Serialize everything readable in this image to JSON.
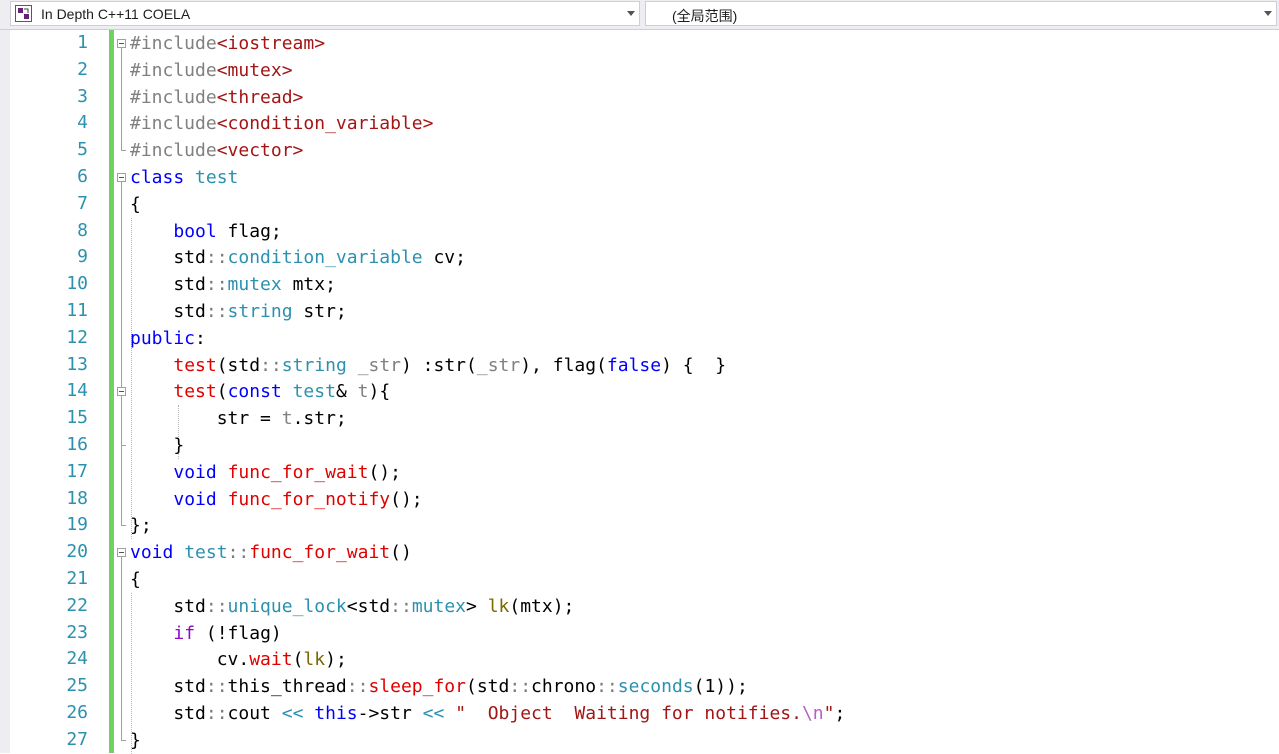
{
  "toolbar": {
    "project_label": "In Depth C++11 COELA",
    "scope_label": "(全局范围)",
    "project_icon": "project-icon"
  },
  "colors": {
    "line_number": "#2b91af",
    "change_bar": "#6cd35e",
    "keyword": "#0000ff",
    "type": "#2b91af",
    "function": "#e00000",
    "string": "#a31515",
    "preprocessor": "#808080"
  },
  "editor": {
    "lines": [
      {
        "n": "1",
        "tokens": [
          [
            "pre",
            "#include"
          ],
          [
            "inc",
            "<iostream>"
          ]
        ]
      },
      {
        "n": "2",
        "tokens": [
          [
            "pre",
            "#include"
          ],
          [
            "inc",
            "<mutex>"
          ]
        ]
      },
      {
        "n": "3",
        "tokens": [
          [
            "pre",
            "#include"
          ],
          [
            "inc",
            "<thread>"
          ]
        ]
      },
      {
        "n": "4",
        "tokens": [
          [
            "pre",
            "#include"
          ],
          [
            "inc",
            "<condition_variable>"
          ]
        ]
      },
      {
        "n": "5",
        "tokens": [
          [
            "pre",
            "#include"
          ],
          [
            "inc",
            "<vector>"
          ]
        ]
      },
      {
        "n": "6",
        "tokens": [
          [
            "kw",
            "class"
          ],
          [
            "plain",
            " "
          ],
          [
            "type",
            "test"
          ]
        ]
      },
      {
        "n": "7",
        "tokens": [
          [
            "plain",
            "{"
          ]
        ]
      },
      {
        "n": "8",
        "tokens": [
          [
            "plain",
            "    "
          ],
          [
            "kw",
            "bool"
          ],
          [
            "plain",
            " flag;"
          ]
        ]
      },
      {
        "n": "9",
        "tokens": [
          [
            "plain",
            "    std"
          ],
          [
            "mem",
            "::"
          ],
          [
            "type",
            "condition_variable"
          ],
          [
            "plain",
            " cv;"
          ]
        ]
      },
      {
        "n": "10",
        "tokens": [
          [
            "plain",
            "    std"
          ],
          [
            "mem",
            "::"
          ],
          [
            "type",
            "mutex"
          ],
          [
            "plain",
            " mtx;"
          ]
        ]
      },
      {
        "n": "11",
        "tokens": [
          [
            "plain",
            "    std"
          ],
          [
            "mem",
            "::"
          ],
          [
            "type",
            "string"
          ],
          [
            "plain",
            " str;"
          ]
        ]
      },
      {
        "n": "12",
        "tokens": [
          [
            "kw",
            "public"
          ],
          [
            "plain",
            ":"
          ]
        ]
      },
      {
        "n": "13",
        "tokens": [
          [
            "plain",
            "    "
          ],
          [
            "fn",
            "test"
          ],
          [
            "plain",
            "(std"
          ],
          [
            "mem",
            "::"
          ],
          [
            "type",
            "string"
          ],
          [
            "plain",
            " "
          ],
          [
            "par",
            "_str"
          ],
          [
            "plain",
            ") :str("
          ],
          [
            "par",
            "_str"
          ],
          [
            "plain",
            "), flag("
          ],
          [
            "kw",
            "false"
          ],
          [
            "plain",
            ") {  }"
          ]
        ]
      },
      {
        "n": "14",
        "tokens": [
          [
            "plain",
            "    "
          ],
          [
            "fn",
            "test"
          ],
          [
            "plain",
            "("
          ],
          [
            "kw",
            "const"
          ],
          [
            "plain",
            " "
          ],
          [
            "type",
            "test"
          ],
          [
            "plain",
            "& "
          ],
          [
            "par",
            "t"
          ],
          [
            "plain",
            "){"
          ]
        ]
      },
      {
        "n": "15",
        "tokens": [
          [
            "plain",
            "        str = "
          ],
          [
            "par",
            "t"
          ],
          [
            "plain",
            ".str;"
          ]
        ]
      },
      {
        "n": "16",
        "tokens": [
          [
            "plain",
            "    }"
          ]
        ]
      },
      {
        "n": "17",
        "tokens": [
          [
            "plain",
            "    "
          ],
          [
            "kw",
            "void"
          ],
          [
            "plain",
            " "
          ],
          [
            "fn",
            "func_for_wait"
          ],
          [
            "plain",
            "();"
          ]
        ]
      },
      {
        "n": "18",
        "tokens": [
          [
            "plain",
            "    "
          ],
          [
            "kw",
            "void"
          ],
          [
            "plain",
            " "
          ],
          [
            "fn",
            "func_for_notify"
          ],
          [
            "plain",
            "();"
          ]
        ]
      },
      {
        "n": "19",
        "tokens": [
          [
            "plain",
            "};"
          ]
        ]
      },
      {
        "n": "20",
        "tokens": [
          [
            "kw",
            "void"
          ],
          [
            "plain",
            " "
          ],
          [
            "type",
            "test"
          ],
          [
            "mem",
            "::"
          ],
          [
            "fn",
            "func_for_wait"
          ],
          [
            "plain",
            "()"
          ]
        ]
      },
      {
        "n": "21",
        "tokens": [
          [
            "plain",
            "{"
          ]
        ]
      },
      {
        "n": "22",
        "tokens": [
          [
            "plain",
            "    std"
          ],
          [
            "mem",
            "::"
          ],
          [
            "type",
            "unique_lock"
          ],
          [
            "plain",
            "<std"
          ],
          [
            "mem",
            "::"
          ],
          [
            "type",
            "mutex"
          ],
          [
            "plain",
            "> "
          ],
          [
            "var",
            "lk"
          ],
          [
            "plain",
            "(mtx);"
          ]
        ]
      },
      {
        "n": "23",
        "tokens": [
          [
            "plain",
            "    "
          ],
          [
            "ctl",
            "if"
          ],
          [
            "plain",
            " (!flag)"
          ]
        ]
      },
      {
        "n": "24",
        "tokens": [
          [
            "plain",
            "        cv."
          ],
          [
            "fn",
            "wait"
          ],
          [
            "plain",
            "("
          ],
          [
            "var",
            "lk"
          ],
          [
            "plain",
            ");"
          ]
        ]
      },
      {
        "n": "25",
        "tokens": [
          [
            "plain",
            "    std"
          ],
          [
            "mem",
            "::"
          ],
          [
            "plain",
            "this_thread"
          ],
          [
            "mem",
            "::"
          ],
          [
            "fn",
            "sleep_for"
          ],
          [
            "plain",
            "(std"
          ],
          [
            "mem",
            "::"
          ],
          [
            "plain",
            "chrono"
          ],
          [
            "mem",
            "::"
          ],
          [
            "type",
            "seconds"
          ],
          [
            "plain",
            "(1));"
          ]
        ]
      },
      {
        "n": "26",
        "tokens": [
          [
            "plain",
            "    std"
          ],
          [
            "mem",
            "::"
          ],
          [
            "plain",
            "cout "
          ],
          [
            "type",
            "<<"
          ],
          [
            "plain",
            " "
          ],
          [
            "kw",
            "this"
          ],
          [
            "plain",
            "->str "
          ],
          [
            "type",
            "<<"
          ],
          [
            "plain",
            " "
          ],
          [
            "str",
            "\"  Object  Waiting for notifies."
          ],
          [
            "esc",
            "\\n"
          ],
          [
            "str",
            "\""
          ],
          [
            "plain",
            ";"
          ]
        ]
      },
      {
        "n": "27",
        "tokens": [
          [
            "plain",
            "}"
          ]
        ]
      }
    ]
  }
}
